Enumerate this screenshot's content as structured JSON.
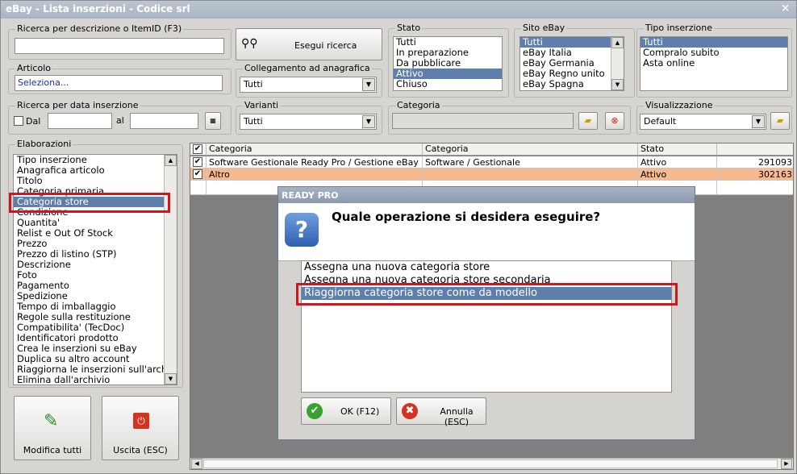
{
  "window": {
    "title": "eBay - Lista inserzioni - Codice srl",
    "close": "×"
  },
  "search": {
    "label": "Ricerca per descrizione o ItemID (F3)",
    "value": "",
    "button": "Esegui ricerca"
  },
  "articolo": {
    "label": "Articolo",
    "value": "Seleziona..."
  },
  "collegamento": {
    "label": "Collegamento ad anagrafica",
    "value": "Tutti"
  },
  "stato": {
    "label": "Stato",
    "items": [
      "Tutti",
      "In preparazione",
      "Da pubblicare",
      "Attivo",
      "Chiuso"
    ],
    "selected_index": 3
  },
  "sito": {
    "label": "Sito eBay",
    "items": [
      "Tutti",
      "eBay Italia",
      "eBay Germania",
      "eBay Regno unito",
      "eBay Spagna"
    ],
    "selected_index": 0
  },
  "tipo": {
    "label": "Tipo inserzione",
    "items": [
      "Tutti",
      "Compralo subito",
      "Asta online"
    ],
    "selected_index": 0
  },
  "data_inserzione": {
    "label": "Ricerca per data inserzione",
    "dal": "Dal",
    "al": "al"
  },
  "varianti": {
    "label": "Varianti",
    "value": "Tutti"
  },
  "categoria": {
    "label": "Categoria",
    "value": ""
  },
  "visualizzazione": {
    "label": "Visualizzazione",
    "value": "Default"
  },
  "elaborazioni": {
    "label": "Elaborazioni",
    "items": [
      "Tipo inserzione",
      "Anagrafica articolo",
      "Titolo",
      "Categoria primaria",
      "Categoria store",
      "Condizione",
      "Quantita'",
      "Relist e Out Of Stock",
      "Prezzo",
      "Prezzo di listino (STP)",
      "Descrizione",
      "Foto",
      "Pagamento",
      "Spedizione",
      "Tempo di imballaggio",
      "Regole sulla restituzione",
      "Compatibilita' (TecDoc)",
      "Identificatori prodotto",
      "Crea le inserzioni su eBay",
      "Duplica su altro account",
      "Riaggiorna le inserzioni sull'arch",
      "Elimina dall'archivio"
    ],
    "selected_index": 4
  },
  "buttons": {
    "modifica": "Modifica tutti",
    "uscita": "Uscita (ESC)"
  },
  "grid": {
    "columns": [
      "Categoria",
      "Categoria",
      "Stato",
      ""
    ],
    "rows": [
      {
        "checked": "✔",
        "cat": "Software Gestionale Ready Pro / Gestione eBay",
        "cat2": "Software / Gestionale",
        "stato": "Attivo",
        "id": "291093"
      },
      {
        "checked": "✔",
        "cat": "Altro",
        "cat2": "",
        "stato": "Attivo",
        "id": "302163"
      }
    ]
  },
  "dialog": {
    "title": "READY PRO",
    "question": "Quale operazione si desidera eseguire?",
    "options": [
      "Assegna una nuova categoria store",
      "Assegna una nuova categoria store secondaria",
      "Riaggiorna categoria store come da modello"
    ],
    "selected_index": 2,
    "ok": "OK (F12)",
    "cancel": "Annulla (ESC)"
  },
  "colors": {
    "selection": "#5e7eab",
    "highlight_row": "#f7b98e",
    "red_box": "#d0161c"
  }
}
